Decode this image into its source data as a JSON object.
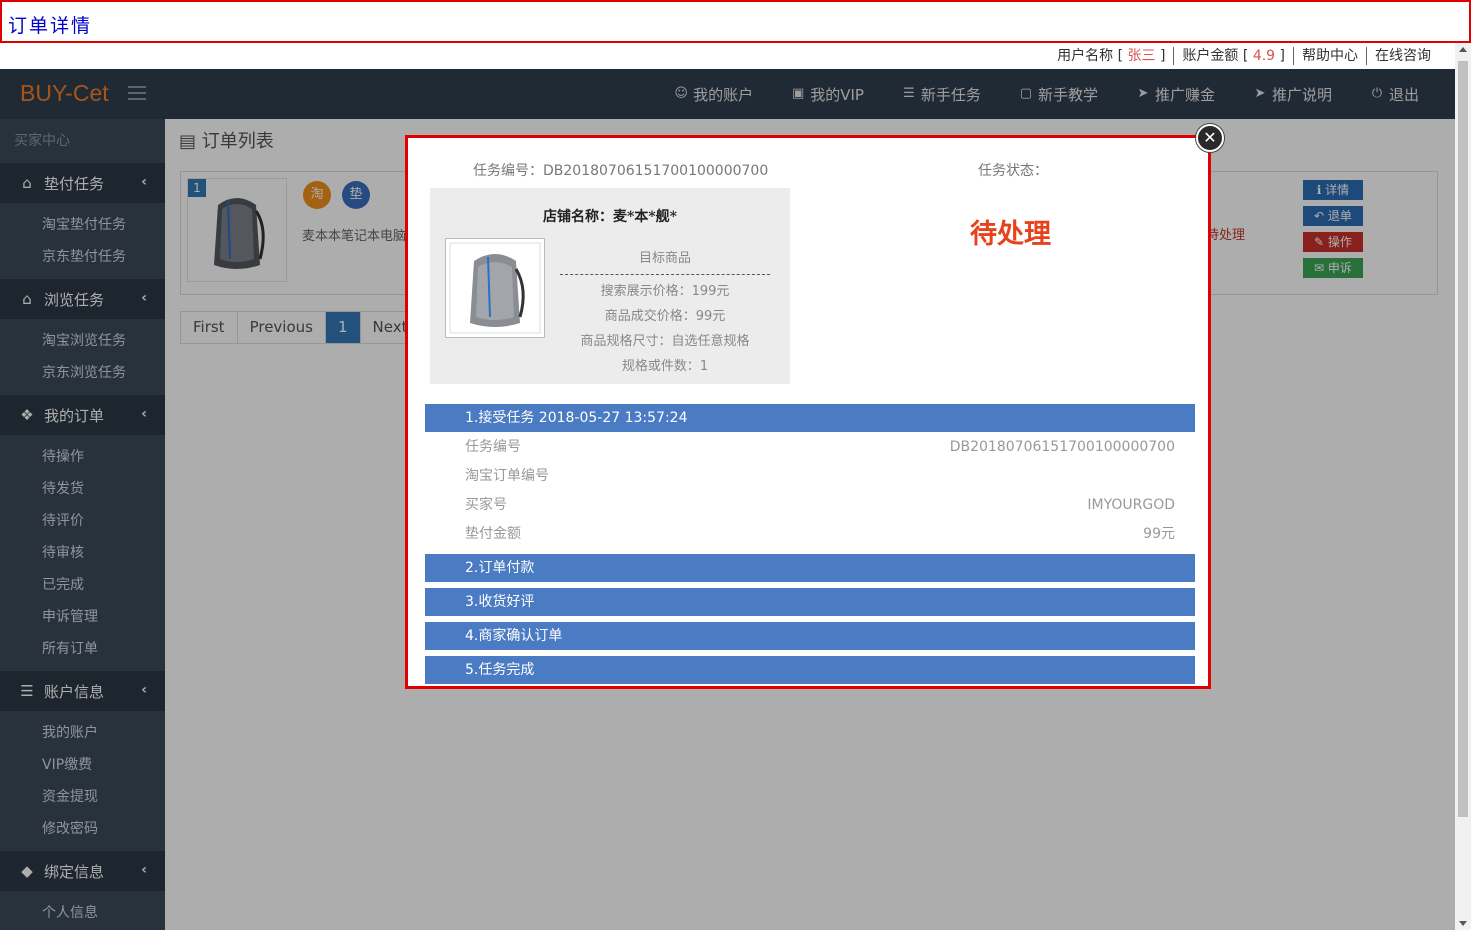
{
  "title": "订单详情",
  "infobar": {
    "user_label": "用户名称",
    "user_name": "张三",
    "balance_label": "账户金额",
    "balance_value": "4.9",
    "help": "帮助中心",
    "consult": "在线咨询"
  },
  "brand": "BUY-Cet",
  "topnav": [
    {
      "label": "我的账户",
      "icon": "user-icon"
    },
    {
      "label": "我的VIP",
      "icon": "vip-icon"
    },
    {
      "label": "新手任务",
      "icon": "list-icon"
    },
    {
      "label": "新手教学",
      "icon": "film-icon"
    },
    {
      "label": "推广赚金",
      "icon": "send-icon"
    },
    {
      "label": "推广说明",
      "icon": "send-icon"
    },
    {
      "label": "退出",
      "icon": "power-icon"
    }
  ],
  "sidebar": {
    "header": "买家中心",
    "sections": [
      {
        "label": "垫付任务",
        "icon": "home-icon",
        "items": [
          "淘宝垫付任务",
          "京东垫付任务"
        ]
      },
      {
        "label": "浏览任务",
        "icon": "home-icon",
        "items": [
          "淘宝浏览任务",
          "京东浏览任务"
        ]
      },
      {
        "label": "我的订单",
        "icon": "tag-icon",
        "items": [
          "待操作",
          "待发货",
          "待评价",
          "待审核",
          "已完成",
          "申诉管理",
          "所有订单"
        ]
      },
      {
        "label": "账户信息",
        "icon": "layers-icon",
        "items": [
          "我的账户",
          "VIP缴费",
          "资金提现",
          "修改密码"
        ]
      },
      {
        "label": "绑定信息",
        "icon": "diamond-icon",
        "items": [
          "个人信息"
        ]
      }
    ]
  },
  "main": {
    "title": "订单列表",
    "order": {
      "index": "1",
      "badge1": "淘",
      "badge2": "垫",
      "product_title": "麦本本笔记本电脑",
      "status": "待处理",
      "buttons": [
        "详情",
        "退单",
        "操作",
        "申诉"
      ]
    },
    "pager": [
      "First",
      "Previous",
      "1",
      "Next"
    ]
  },
  "modal": {
    "task_no_label": "任务编号：DB20180706151700100000700",
    "status_label": "任务状态：",
    "status": "待处理",
    "shop_name": "店铺名称：麦*本*舰*",
    "target_label": "目标商品",
    "display_price": "搜索展示价格：199元",
    "deal_price": "商品成交价格：99元",
    "spec": "商品规格尺寸：自选任意规格",
    "quantity": "规格或件数：1",
    "steps": [
      "1.接受任务 2018-05-27 13:57:24",
      "2.订单付款",
      "3.收货好评",
      "4.商家确认订单",
      "5.任务完成"
    ],
    "details": [
      {
        "label": "任务编号",
        "value": "DB20180706151700100000700"
      },
      {
        "label": "淘宝订单编号",
        "value": ""
      },
      {
        "label": "买家号",
        "value": "IMYOURGOD"
      },
      {
        "label": "垫付金额",
        "value": "99元"
      }
    ]
  },
  "colors": {
    "brand": "#f57c28",
    "nav_bg": "#2f3f4f",
    "sidebar_bg": "#3a4a5a",
    "step_bar": "#4a7bc3",
    "status_red": "#e8421a",
    "btn_detail": "#337ab7",
    "btn_cancel": "#337ab7",
    "btn_operate": "#d9534f",
    "btn_appeal": "#5cb85c"
  }
}
